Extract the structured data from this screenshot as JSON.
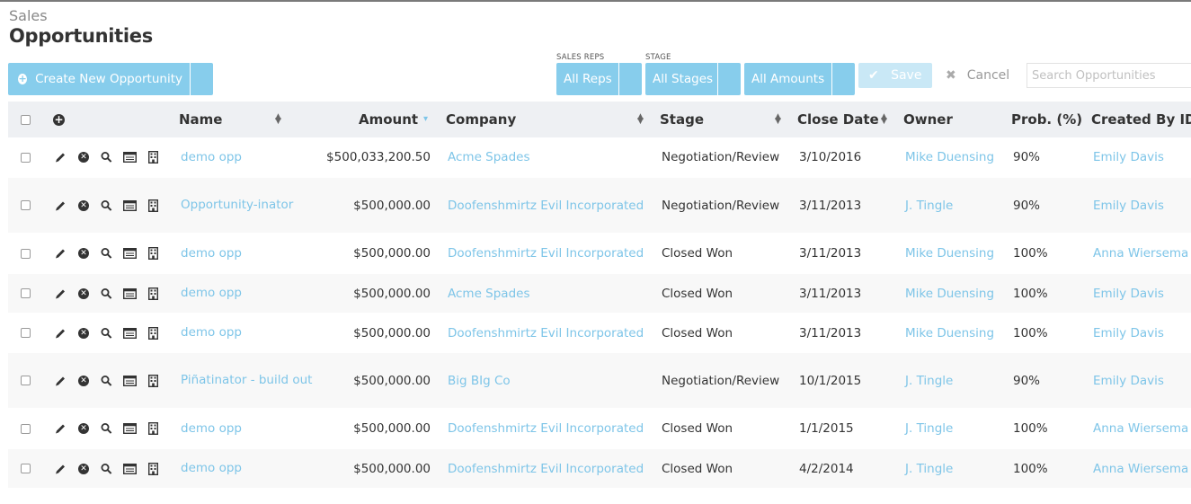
{
  "header": {
    "crumb": "Sales",
    "title": "Opportunities"
  },
  "toolbar": {
    "create_label": "Create New Opportunity",
    "reps_label": "SALES REPS",
    "reps_value": "All Reps",
    "stage_label": "STAGE",
    "stage_value": "All Stages",
    "amounts_value": "All Amounts",
    "save_label": "Save",
    "cancel_label": "Cancel",
    "search_placeholder": "Search Opportunities"
  },
  "colors": {
    "accent": "#87cdec",
    "link": "#7ec5e8",
    "header_bg": "#eef0f3"
  },
  "table": {
    "columns": {
      "name": "Name",
      "amount": "Amount",
      "company": "Company",
      "stage": "Stage",
      "close_date": "Close Date",
      "owner": "Owner",
      "prob": "Prob. (%)",
      "created_by": "Created By ID"
    },
    "rows": [
      {
        "name": "demo opp",
        "amount": "$500,033,200.50",
        "company": "Acme Spades",
        "stage": "Negotiation/Review",
        "close_date": "3/10/2016",
        "owner": "Mike Duensing",
        "prob": "90%",
        "created_by": "Emily Davis"
      },
      {
        "name": "Opportunity-inator",
        "amount": "$500,000.00",
        "company": "Doofenshmirtz Evil Incorporated",
        "stage": "Negotiation/Review",
        "close_date": "3/11/2013",
        "owner": "J. Tingle",
        "prob": "90%",
        "created_by": "Emily Davis"
      },
      {
        "name": "demo opp",
        "amount": "$500,000.00",
        "company": "Doofenshmirtz Evil Incorporated",
        "stage": "Closed Won",
        "close_date": "3/11/2013",
        "owner": "Mike Duensing",
        "prob": "100%",
        "created_by": "Anna Wiersema"
      },
      {
        "name": "demo opp",
        "amount": "$500,000.00",
        "company": "Acme Spades",
        "stage": "Closed Won",
        "close_date": "3/11/2013",
        "owner": "Mike Duensing",
        "prob": "100%",
        "created_by": "Emily Davis"
      },
      {
        "name": "demo opp",
        "amount": "$500,000.00",
        "company": "Doofenshmirtz Evil Incorporated",
        "stage": "Closed Won",
        "close_date": "3/11/2013",
        "owner": "Mike Duensing",
        "prob": "100%",
        "created_by": "Emily Davis"
      },
      {
        "name": "Piñatinator - build out",
        "amount": "$500,000.00",
        "company": "Big BIg Co",
        "stage": "Negotiation/Review",
        "close_date": "10/1/2015",
        "owner": "J. Tingle",
        "prob": "90%",
        "created_by": "Emily Davis"
      },
      {
        "name": "demo opp",
        "amount": "$500,000.00",
        "company": "Doofenshmirtz Evil Incorporated",
        "stage": "Closed Won",
        "close_date": "1/1/2015",
        "owner": "J. Tingle",
        "prob": "100%",
        "created_by": "Anna Wiersema"
      },
      {
        "name": "demo opp",
        "amount": "$500,000.00",
        "company": "Doofenshmirtz Evil Incorporated",
        "stage": "Closed Won",
        "close_date": "4/2/2014",
        "owner": "J. Tingle",
        "prob": "100%",
        "created_by": "Anna Wiersema"
      }
    ]
  }
}
